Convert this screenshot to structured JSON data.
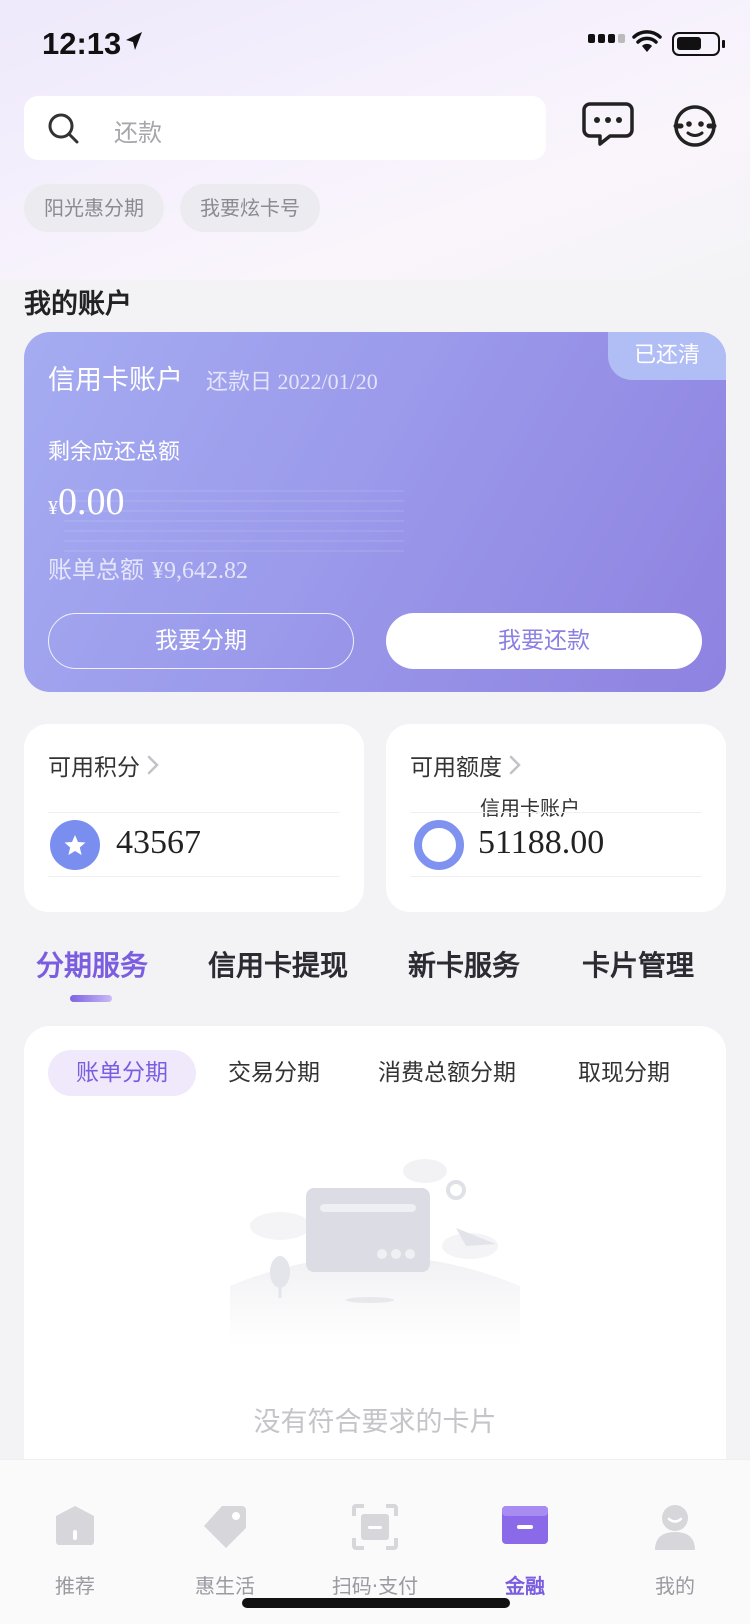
{
  "status_bar": {
    "time": "12:13"
  },
  "search": {
    "placeholder": "还款"
  },
  "quick_chips": [
    "阳光惠分期",
    "我要炫卡号"
  ],
  "account_section": {
    "title": "我的账户",
    "card": {
      "title": "信用卡账户",
      "due_label": "还款日",
      "due_date": "2022/01/20",
      "status_badge": "已还清",
      "remaining_label": "剩余应还总额",
      "currency_symbol": "¥",
      "remaining_amount": "0.00",
      "bill_total_label": "账单总额",
      "bill_total_value": "¥9,642.82",
      "btn_installment": "我要分期",
      "btn_repay": "我要还款"
    }
  },
  "points": {
    "title": "可用积分",
    "value": "43567"
  },
  "credit_limit": {
    "title": "可用额度",
    "subtitle": "信用卡账户",
    "value": "51188.00"
  },
  "main_tabs": [
    "分期服务",
    "信用卡提现",
    "新卡服务",
    "卡片管理"
  ],
  "sub_tabs": [
    "账单分期",
    "交易分期",
    "消费总额分期",
    "取现分期"
  ],
  "empty_state": {
    "text": "没有符合要求的卡片"
  },
  "bottom_nav": [
    {
      "label": "推荐",
      "icon": "home-icon"
    },
    {
      "label": "惠生活",
      "icon": "tag-icon"
    },
    {
      "label": "扫码·支付",
      "icon": "scan-icon"
    },
    {
      "label": "金融",
      "icon": "card-icon"
    },
    {
      "label": "我的",
      "icon": "profile-icon"
    }
  ],
  "colors": {
    "accent": "#7b5ee0",
    "card_gradient_start": "#a5acf1",
    "card_gradient_end": "#8e82e0"
  }
}
